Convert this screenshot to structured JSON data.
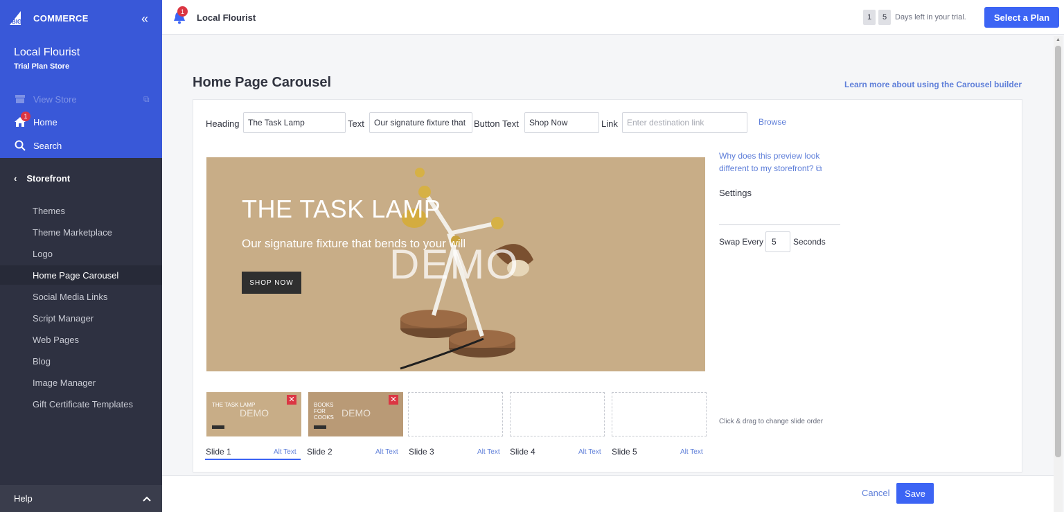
{
  "sidebar": {
    "logo_text": "COMMERCE",
    "logo_prefix": "BIG",
    "store_name": "Local Flourist",
    "store_plan": "Trial Plan Store",
    "view_store": "View Store",
    "home": "Home",
    "home_badge": "1",
    "search": "Search",
    "section": "Storefront",
    "items": [
      {
        "label": "Themes"
      },
      {
        "label": "Theme Marketplace"
      },
      {
        "label": "Logo"
      },
      {
        "label": "Home Page Carousel"
      },
      {
        "label": "Social Media Links"
      },
      {
        "label": "Script Manager"
      },
      {
        "label": "Web Pages"
      },
      {
        "label": "Blog"
      },
      {
        "label": "Image Manager"
      },
      {
        "label": "Gift Certificate Templates"
      }
    ],
    "help": "Help",
    "colors": {
      "top": "#3958d8",
      "body": "#2e3141"
    }
  },
  "topbar": {
    "notification_count": "1",
    "store_name": "Local Flourist",
    "trial_digits": [
      "1",
      "5"
    ],
    "trial_text": "Days left in your trial.",
    "select_plan": "Select a Plan"
  },
  "main": {
    "title": "Home Page Carousel",
    "learn_link": "Learn more about using the Carousel builder",
    "form": {
      "heading_label": "Heading",
      "heading_value": "The Task Lamp",
      "text_label": "Text",
      "text_value": "Our signature fixture that bends to your will",
      "button_label": "Button Text",
      "button_value": "Shop Now",
      "link_label": "Link",
      "link_placeholder": "Enter destination link",
      "browse": "Browse"
    },
    "preview": {
      "heading": "THE TASK LAMP",
      "text": "Our signature fixture that bends to your will",
      "button": "SHOP NOW",
      "watermark": "DEMO"
    },
    "side": {
      "why": "Why does this preview look different to my storefront?",
      "settings": "Settings",
      "swap_every": "Swap Every",
      "swap_value": "5",
      "seconds": "Seconds",
      "drag_hint": "Click & drag to change slide order"
    },
    "slides": [
      {
        "label": "Slide 1",
        "alt": "Alt Text",
        "thumb_title": "THE TASK LAMP",
        "filled": true
      },
      {
        "label": "Slide 2",
        "alt": "Alt Text",
        "thumb_title": "BOOKS FOR COOKS",
        "filled": true
      },
      {
        "label": "Slide 3",
        "alt": "Alt Text",
        "filled": false
      },
      {
        "label": "Slide 4",
        "alt": "Alt Text",
        "filled": false
      },
      {
        "label": "Slide 5",
        "alt": "Alt Text",
        "filled": false
      }
    ],
    "thumb_watermark": "DEMO",
    "close_glyph": "✕"
  },
  "footer": {
    "cancel": "Cancel",
    "save": "Save"
  },
  "colors": {
    "accent": "#3c64f4",
    "link": "#5f7fd9",
    "danger": "#db3643",
    "preview_bg": "#c8ad87"
  }
}
